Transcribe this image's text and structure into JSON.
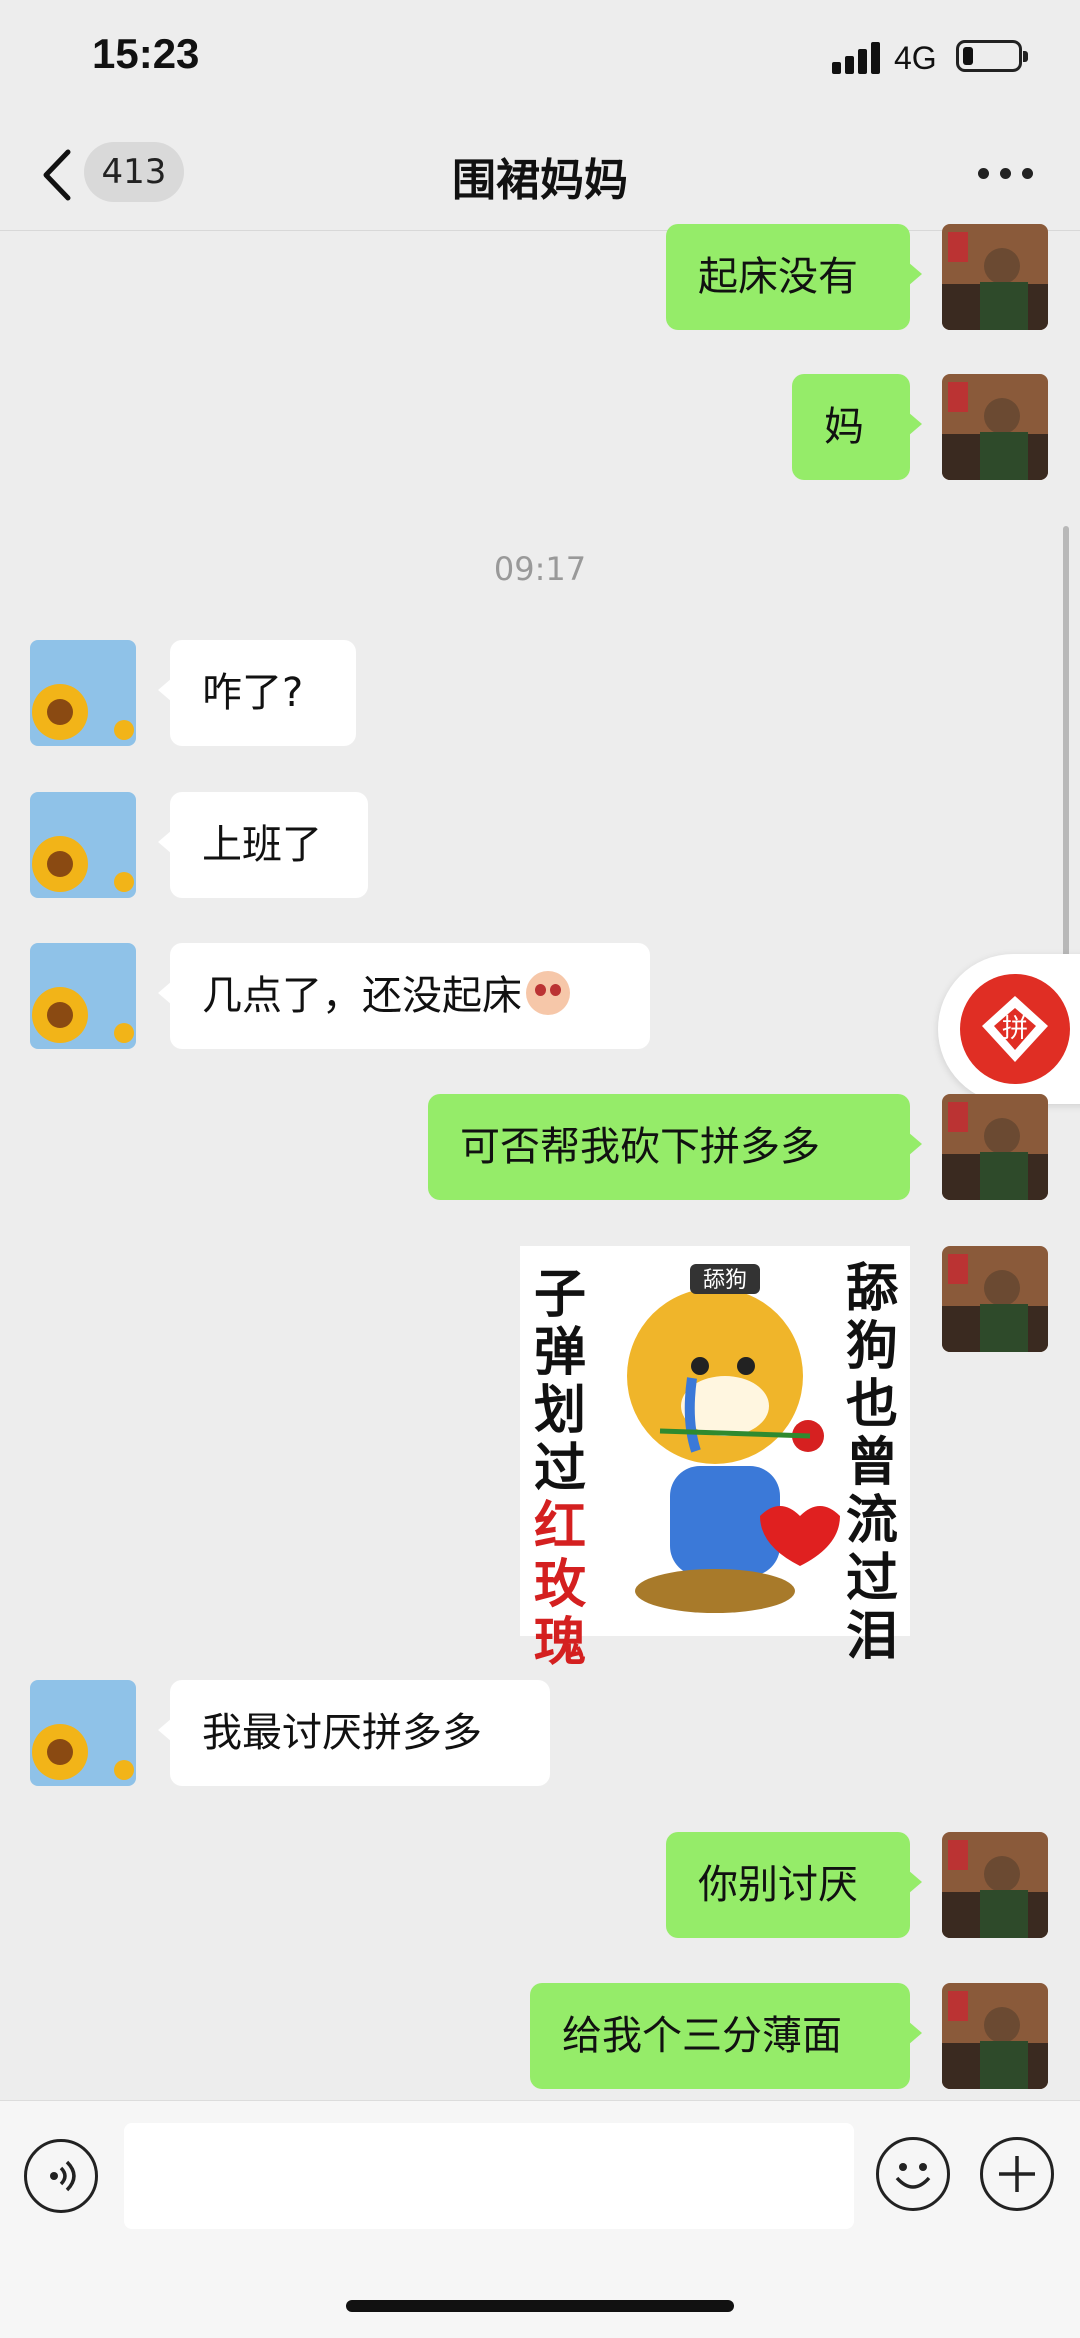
{
  "status_bar": {
    "time": "15:23",
    "network": "4G",
    "battery_icon": "battery-low-icon",
    "signal_icon": "signal-bars-icon"
  },
  "header": {
    "back_icon": "chevron-left-icon",
    "unread_count": "413",
    "title": "围裙妈妈",
    "more_icon": "more-dots-icon"
  },
  "timestamp": "09:17",
  "messages": [
    {
      "from": "me",
      "text": "起床没有"
    },
    {
      "from": "me",
      "text": "妈"
    },
    {
      "from": "them",
      "text": "咋了?"
    },
    {
      "from": "them",
      "text": "上班了"
    },
    {
      "from": "them",
      "text": "几点了，还没起床",
      "emoji": "flushed-face-emoji"
    },
    {
      "from": "me",
      "text": "可否帮我砍下拼多多"
    },
    {
      "from": "me",
      "type": "sticker",
      "sticker": {
        "left_text": "子弹划过",
        "left_red_text": "红玫瑰",
        "right_text": "舔狗也曾流过泪",
        "label": "舔狗"
      }
    },
    {
      "from": "them",
      "text": "我最讨厌拼多多"
    },
    {
      "from": "me",
      "text": "你别讨厌"
    },
    {
      "from": "me",
      "text": "给我个三分薄面"
    }
  ],
  "floating_widget": {
    "name": "拼",
    "icon": "pinduoduo-logo-icon"
  },
  "input_bar": {
    "voice_icon": "voice-icon",
    "emoji_icon": "smiley-icon",
    "plus_icon": "plus-icon",
    "input_value": ""
  },
  "colors": {
    "background": "#ededed",
    "my_bubble": "#95ec69",
    "their_bubble": "#ffffff",
    "brand_red": "#e02e24"
  }
}
